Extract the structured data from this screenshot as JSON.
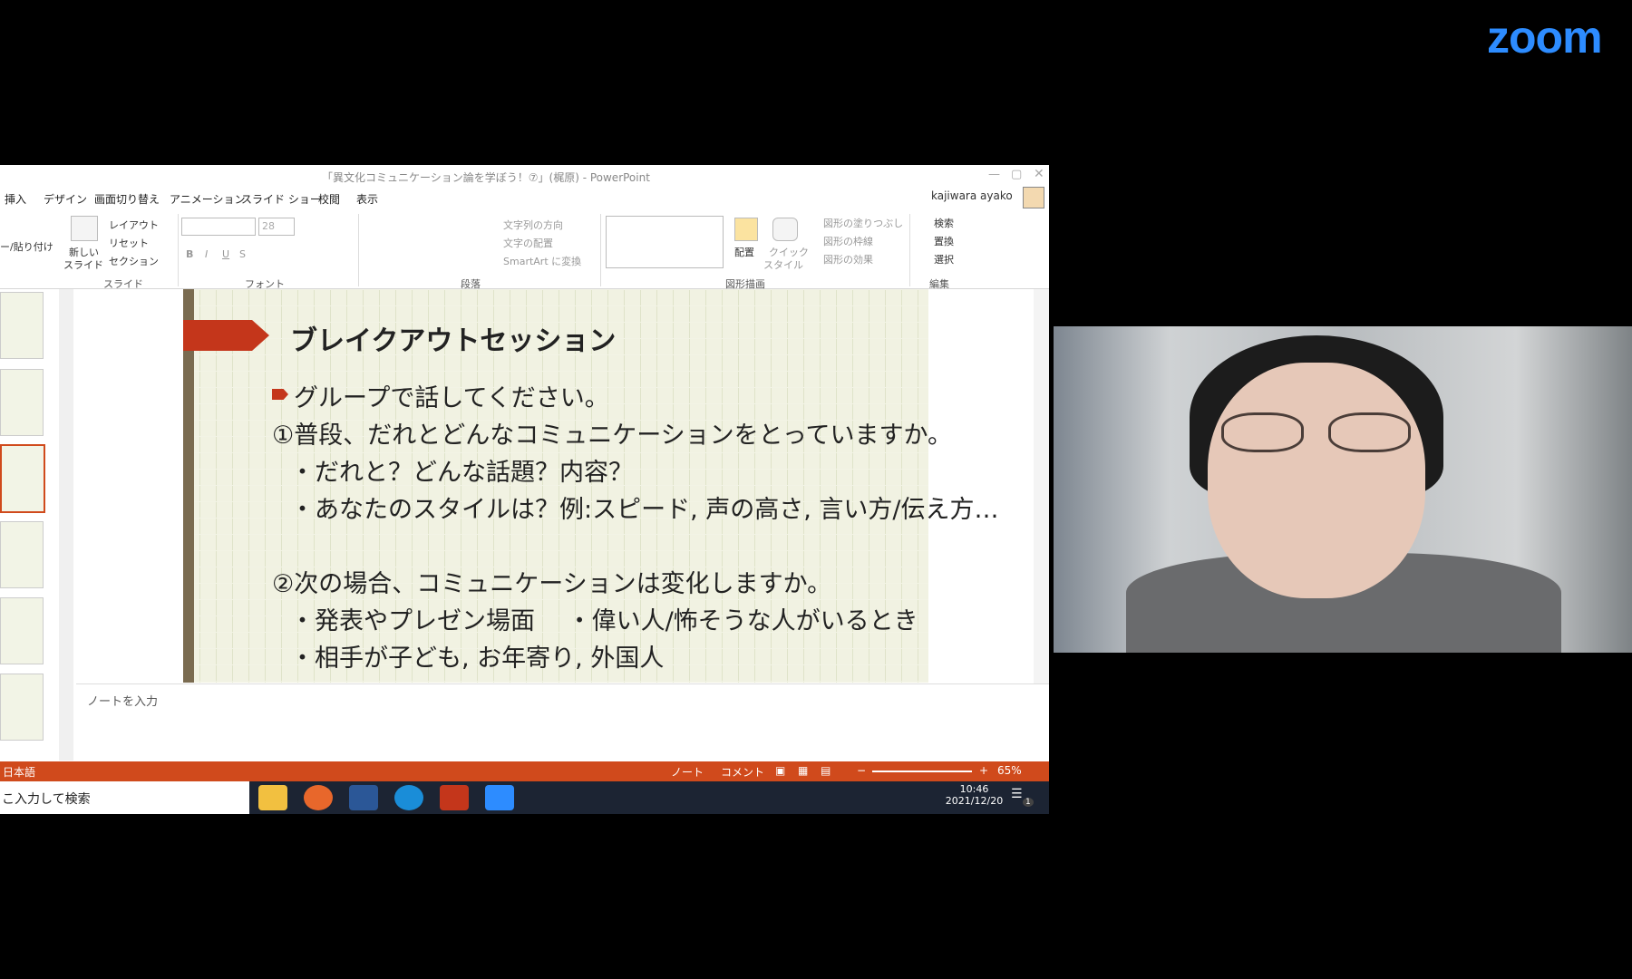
{
  "zoom_logo": "zoom",
  "ppt": {
    "title": "「異文化コミュニケーション論を学ぼう！⑦」(梶原) - PowerPoint",
    "tabs": [
      "挿入",
      "デザイン",
      "画面切り替え",
      "アニメーション",
      "スライド ショー",
      "校閲",
      "表示"
    ],
    "user": "kajiwara ayako",
    "ribbon": {
      "paste_group_label": "ー/貼り付け",
      "new_slide": "新しい",
      "new_slide2": "スライド",
      "layout": "レイアウト",
      "reset": "リセット",
      "section": "セクション",
      "slides_group": "スライド",
      "font_size": "28",
      "font_group": "フォント",
      "text_direction": "文字列の方向",
      "text_align": "文字の配置",
      "smartart": "SmartArt に変換",
      "paragraph_group": "段落",
      "arrange": "配置",
      "quick_style": "クイック",
      "quick_style2": "スタイル",
      "shape_fill": "図形の塗りつぶし",
      "shape_outline": "図形の枠線",
      "shape_effects": "図形の効果",
      "drawing_group": "図形描画",
      "find": "検索",
      "replace": "置換",
      "select": "選択",
      "editing_group": "編集"
    },
    "slide": {
      "title": "ブレイクアウトセッション",
      "lines": [
        "グループで話してください。",
        "①普段、だれとどんなコミュニケーションをとっていますか。",
        "・だれと？どんな話題？内容？",
        "・あなたのスタイルは？例:スピード, 声の高さ, 言い方/伝え方…",
        "②次の場合、コミュニケーションは変化しますか。",
        "・発表やプレゼン場面　 ・偉い人/怖そうな人がいるとき",
        "・相手が子ども, お年寄り, 外国人"
      ]
    },
    "notes_placeholder": "ノートを入力",
    "status": {
      "language": "日本語",
      "notes": "ノート",
      "comments": "コメント",
      "zoom": "65%"
    }
  },
  "taskbar": {
    "search": "こ入力して検索",
    "time": "10:46",
    "date": "2021/12/20",
    "notification_count": "1"
  },
  "colors": {
    "accent": "#d04a1c",
    "zoom_blue": "#2d8cff"
  }
}
